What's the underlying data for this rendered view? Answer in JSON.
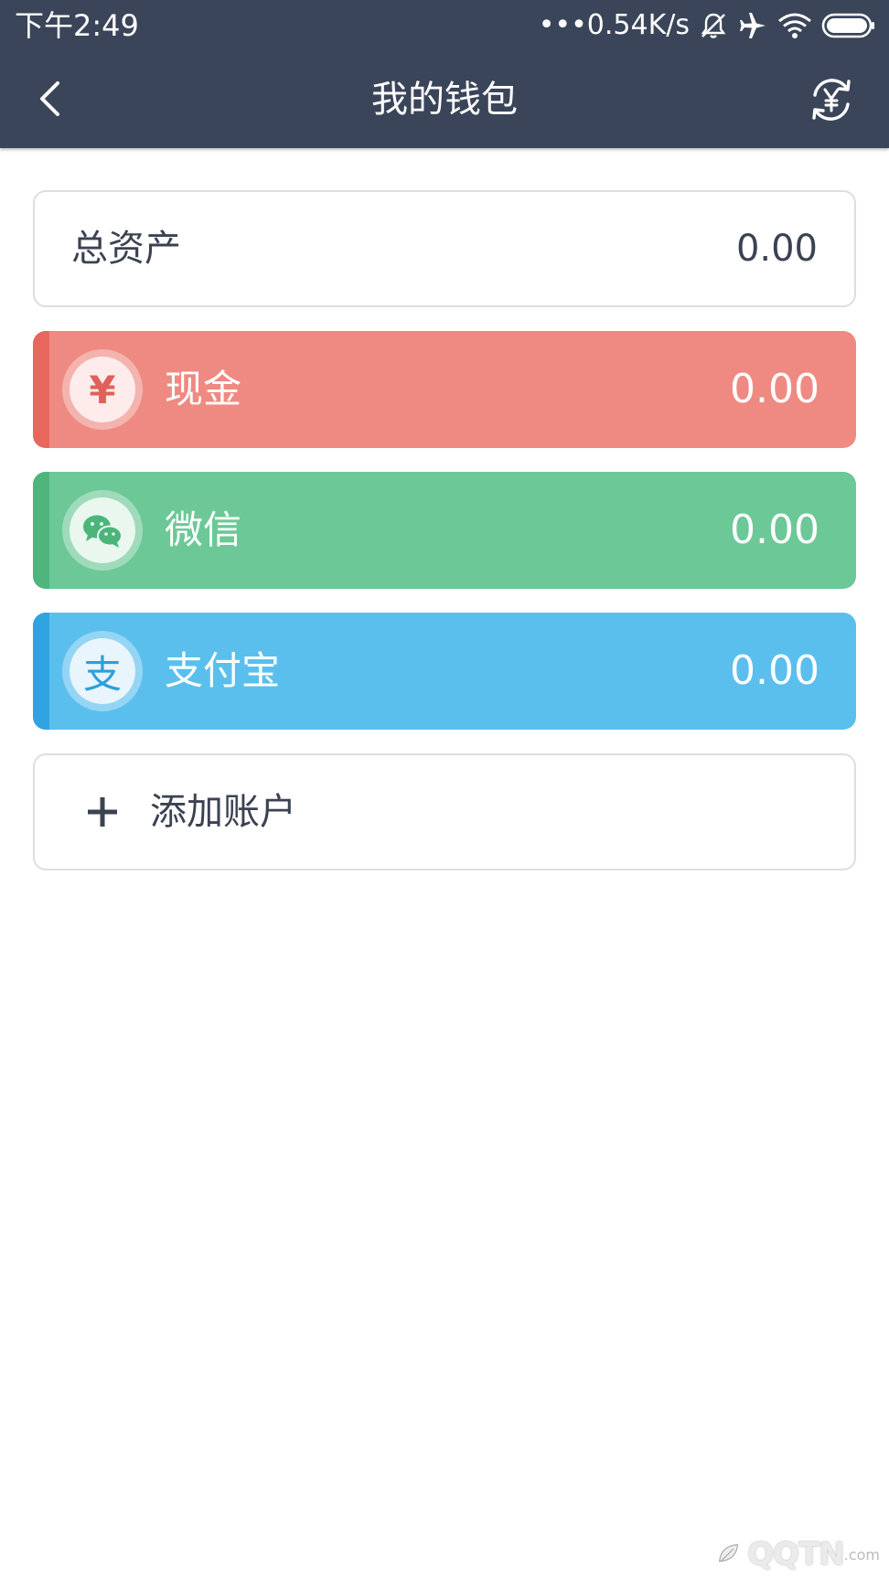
{
  "status_bar": {
    "time": "下午2:49",
    "speed": "•••0.54K/s"
  },
  "nav": {
    "title": "我的钱包"
  },
  "total": {
    "label": "总资产",
    "value": "0.00"
  },
  "accounts": [
    {
      "name": "现金",
      "value": "0.00",
      "icon_glyph": "¥",
      "icon": "yuan-icon",
      "color": "#ef8a82",
      "stripe_color": "#e8675d",
      "icon_color": "#e0605a"
    },
    {
      "name": "微信",
      "value": "0.00",
      "icon": "wechat-icon",
      "color": "#6cc897",
      "stripe_color": "#4fb57c",
      "icon_color": "#4bb57a"
    },
    {
      "name": "支付宝",
      "value": "0.00",
      "icon_glyph": "支",
      "icon": "alipay-icon",
      "color": "#5bbfee",
      "stripe_color": "#2fa3e0",
      "icon_color": "#2d9fdc"
    }
  ],
  "add_account": {
    "label": "添加账户"
  },
  "watermark": {
    "text": "QQTN",
    "small": ".com"
  },
  "colors": {
    "header": "#3b4559",
    "text_dark": "#3b4252",
    "border": "#dcdee2"
  }
}
